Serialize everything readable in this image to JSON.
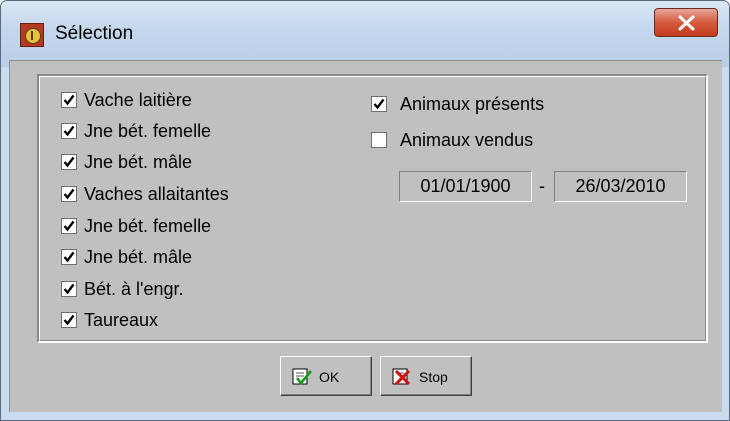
{
  "window": {
    "title": "Sélection"
  },
  "checkboxes_left": [
    {
      "label": "Vache laitière",
      "checked": true
    },
    {
      "label": "Jne bét. femelle",
      "checked": true
    },
    {
      "label": "Jne bét. mâle",
      "checked": true
    },
    {
      "label": "Vaches allaitantes",
      "checked": true
    },
    {
      "label": "Jne bét. femelle",
      "checked": true
    },
    {
      "label": "Jne bét. mâle",
      "checked": true
    },
    {
      "label": "Bét. à l'engr.",
      "checked": true
    },
    {
      "label": "Taureaux",
      "checked": true
    }
  ],
  "checkboxes_right": [
    {
      "label": "Animaux présents",
      "checked": true
    },
    {
      "label": "Animaux vendus",
      "checked": false
    }
  ],
  "date_range": {
    "from": "01/01/1900",
    "separator": "-",
    "to": "26/03/2010"
  },
  "buttons": {
    "ok_label": "OK",
    "stop_label": "Stop"
  },
  "colors": {
    "titlebar": "#c3d6ec",
    "close_button": "#c33c1f",
    "dialog_face": "#c0c0c0"
  }
}
